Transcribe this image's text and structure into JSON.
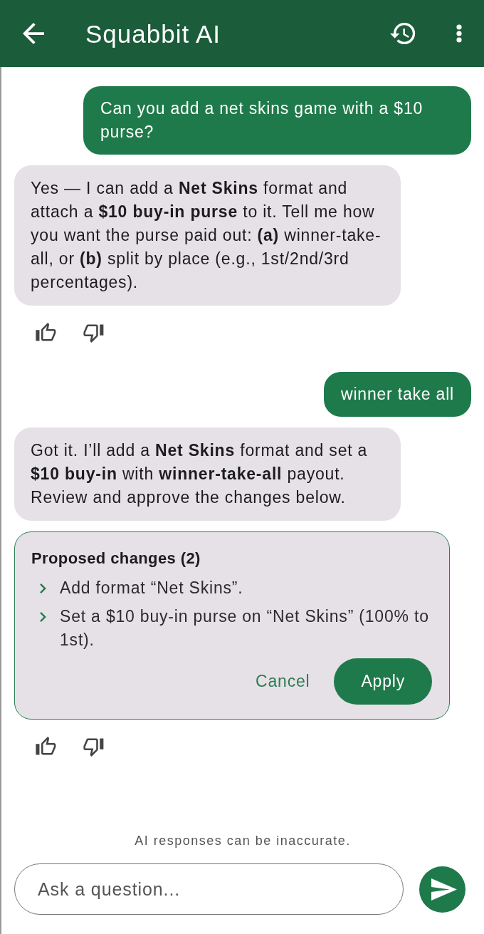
{
  "app_bar": {
    "title": "Squabbit AI"
  },
  "conversation": [
    {
      "kind": "user",
      "text": "Can you add a net skins game with a  $10 purse?"
    },
    {
      "kind": "assistant",
      "text": "Yes — I can add a **Net Skins** format and attach a **$10 buy-in purse** to it. Tell me how you want the purse paid out: **(a)** winner-take-all, or **(b)** split by place (e.g., 1st/2nd/3rd percentages)."
    },
    {
      "kind": "feedback"
    },
    {
      "kind": "user",
      "text": "winner take all"
    },
    {
      "kind": "assistant",
      "text": "Got it. I’ll add a **Net Skins** format and set a **$10 buy-in** with **winner-take-all** payout. Review and approve the changes below."
    },
    {
      "kind": "proposal",
      "title": "Proposed changes (2)",
      "changes": [
        "Add format “Net Skins”.",
        "Set a $10 buy-in purse on “Net Skins” (100% to 1st)."
      ],
      "actions": [
        {
          "kind": "text",
          "label": "Cancel"
        },
        {
          "kind": "filled",
          "label": "Apply"
        }
      ]
    },
    {
      "kind": "feedback"
    }
  ],
  "footer": {
    "disclaimer": "AI responses can be inaccurate.",
    "input": {
      "placeholder": "Ask a question..."
    }
  }
}
